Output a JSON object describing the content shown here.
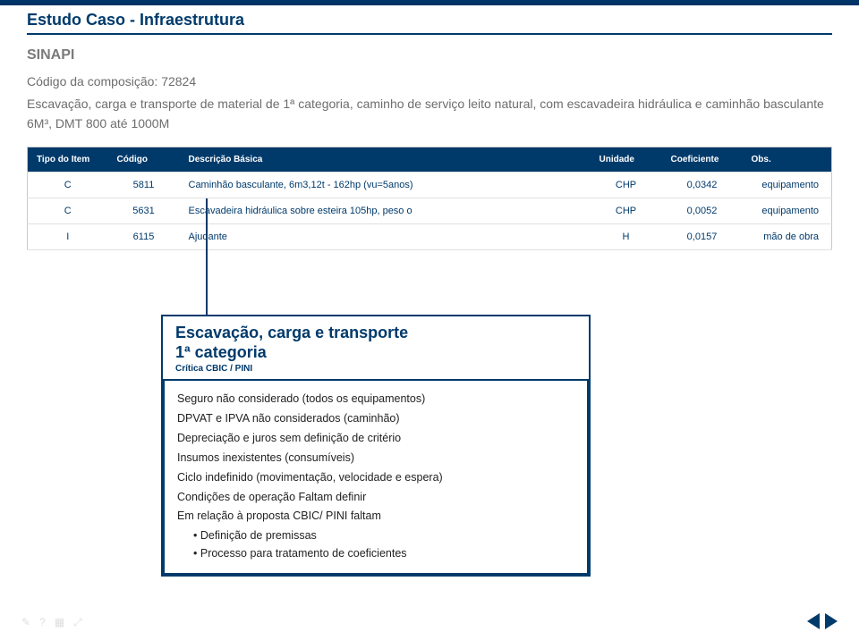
{
  "header": {
    "page_title": "Estudo Caso - Infraestrutura",
    "subtitle": "SINAPI",
    "comp_code_line": "Código da composição: 72824",
    "comp_desc": "Escavação, carga e transporte de material de 1ª categoria, caminho de serviço leito natural, com escavadeira hidráulica e caminhão basculante 6M³, DMT 800 até 1000M"
  },
  "table": {
    "headers": {
      "tipo": "Tipo do Item",
      "codigo": "Código",
      "desc": "Descrição Básica",
      "unidade": "Unidade",
      "coef": "Coeficiente",
      "obs": "Obs."
    },
    "rows": [
      {
        "tipo": "C",
        "codigo": "5811",
        "desc": "Caminhão basculante, 6m3,12t - 162hp (vu=5anos)",
        "unidade": "CHP",
        "coef": "0,0342",
        "obs": "equipamento"
      },
      {
        "tipo": "C",
        "codigo": "5631",
        "desc": "Escavadeira hidráulica sobre esteira 105hp, peso o",
        "unidade": "CHP",
        "coef": "0,0052",
        "obs": "equipamento"
      },
      {
        "tipo": "I",
        "codigo": "6115",
        "desc": "Ajudante",
        "unidade": "H",
        "coef": "0,0157",
        "obs": "mão de obra"
      }
    ]
  },
  "callout": {
    "title_line1": "Escavação, carga e transporte",
    "title_line2": "1ª categoria",
    "subtitle": "Crítica CBIC / PINI",
    "bullets": [
      "Seguro não considerado (todos os equipamentos)",
      "DPVAT e IPVA não considerados (caminhão)",
      "Depreciação e juros sem definição de critério",
      "Insumos inexistentes (consumíveis)",
      "Ciclo indefinido (movimentação, velocidade e espera)",
      "Condições de operação Faltam definir",
      "Em relação à proposta CBIC/ PINI faltam"
    ],
    "sub_bullets": [
      "Definição de premissas",
      "Processo para tratamento de coeficientes"
    ]
  },
  "icons": {
    "pencil": "✎",
    "help": "?",
    "grid": "▦",
    "expand": "⤢"
  }
}
